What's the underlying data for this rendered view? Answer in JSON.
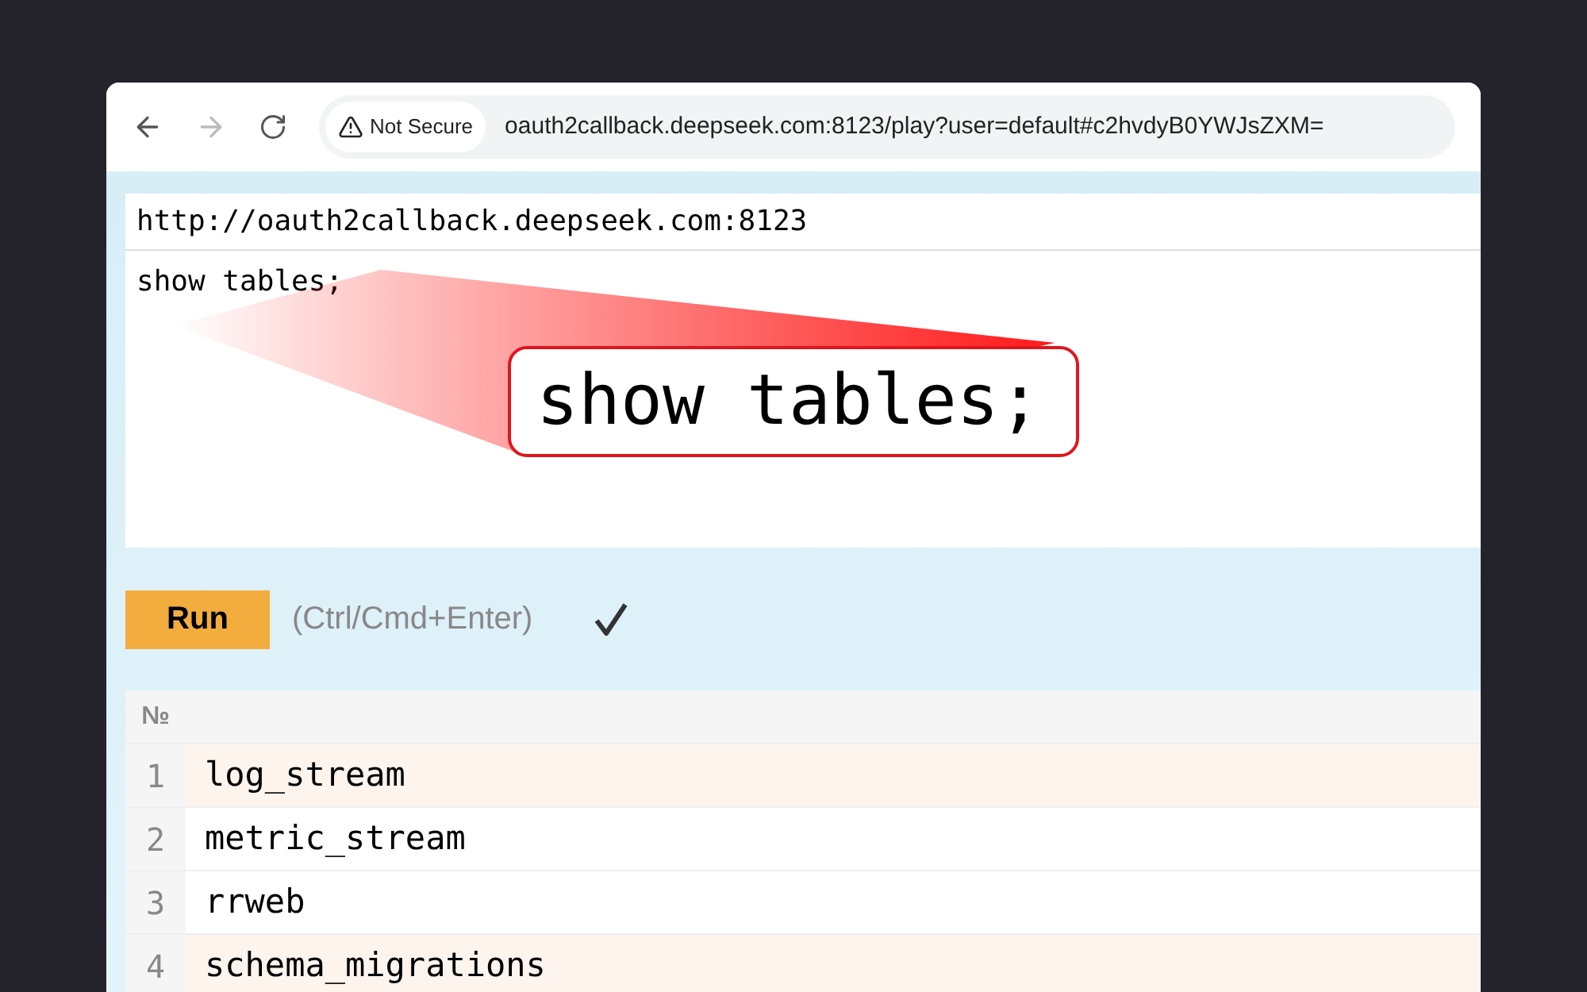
{
  "browser": {
    "security": "Not Secure",
    "url": "oauth2callback.deepseek.com:8123/play?user=default#c2hvdyB0YWJsZXM="
  },
  "host": {
    "value": "http://oauth2callback.deepseek.com:8123"
  },
  "query": {
    "value": "show tables;"
  },
  "callout": {
    "text": "show tables;"
  },
  "run": {
    "label": "Run",
    "hint": "(Ctrl/Cmd+Enter)",
    "succeeded": true
  },
  "table": {
    "columns": [
      "№"
    ],
    "rows": [
      {
        "number": "1",
        "value": "log_stream",
        "highlighted": true
      },
      {
        "number": "2",
        "value": "metric_stream",
        "highlighted": false
      },
      {
        "number": "3",
        "value": "rrweb",
        "highlighted": false
      },
      {
        "number": "4",
        "value": "schema_migrations",
        "highlighted": true
      }
    ]
  }
}
